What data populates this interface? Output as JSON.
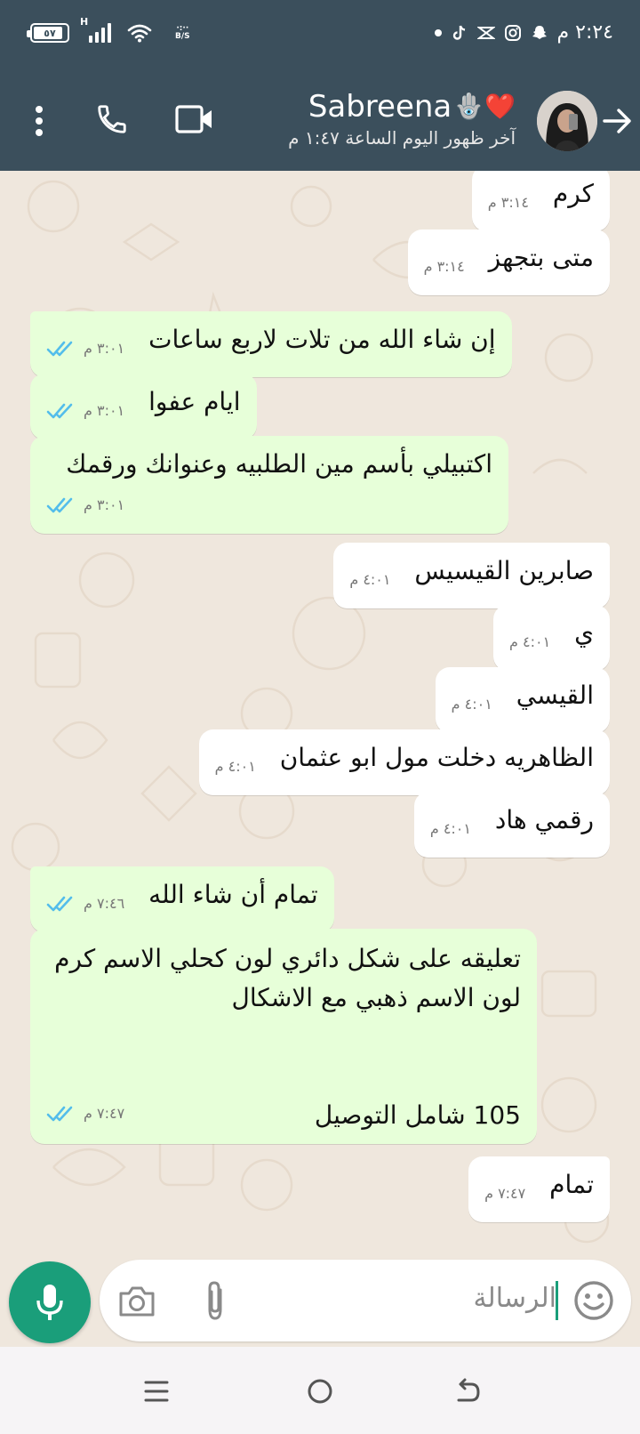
{
  "status_bar": {
    "time": "٢:٢٤ م",
    "battery": "٥٧",
    "network": "H",
    "data_speed_top": "·:··",
    "data_speed_bottom": "B/S"
  },
  "header": {
    "contact_name": "Sabreena",
    "emoji": "🪬❤️",
    "last_seen": "آخر ظهور اليوم الساعة ١:٤٧ م"
  },
  "messages": [
    {
      "dir": "in",
      "text": "كرم",
      "time": "٣:١٤ م"
    },
    {
      "dir": "in",
      "text": "متى بتجهز",
      "time": "٣:١٤ م"
    },
    {
      "dir": "out",
      "text": "إن شاء الله من تلات لاربع ساعات",
      "time": "٣:٠١ م"
    },
    {
      "dir": "out",
      "text": "ايام عفوا",
      "time": "٣:٠١ م"
    },
    {
      "dir": "out",
      "text": "اكتبيلي بأسم مين الطلبيه وعنوانك ورقمك",
      "time": "٣:٠١ م"
    },
    {
      "dir": "in",
      "text": "صابرين القيسيس",
      "time": "٤:٠١ م"
    },
    {
      "dir": "in",
      "text": "ي",
      "time": "٤:٠١ م"
    },
    {
      "dir": "in",
      "text": "القيسي",
      "time": "٤:٠١ م"
    },
    {
      "dir": "in",
      "text": "الظاهريه دخلت مول ابو عثمان",
      "time": "٤:٠١ م"
    },
    {
      "dir": "in",
      "text": "رقمي هاد",
      "time": "٤:٠١ م"
    },
    {
      "dir": "out",
      "text": "تمام أن شاء الله",
      "time": "٧:٤٦ م"
    },
    {
      "dir": "out",
      "text": "تعليقه على شكل دائري لون كحلي الاسم كرم\nلون الاسم ذهبي مع الاشكال\n\n\n105 شامل التوصيل",
      "time": "٧:٤٧ م"
    },
    {
      "dir": "in",
      "text": "تمام",
      "time": "٧:٤٧ م"
    }
  ],
  "input": {
    "placeholder": "الرسالة"
  },
  "icons": {
    "mic": "mic-icon",
    "camera": "camera-icon",
    "attach": "paperclip-icon",
    "emoji": "emoji-icon",
    "call": "phone-icon",
    "video": "video-icon",
    "menu": "more-vert-icon",
    "back": "back-arrow-icon"
  },
  "colors": {
    "header": "#3b4f5c",
    "outgoing_bubble": "#e7ffd9",
    "incoming_bubble": "#ffffff",
    "accent": "#1a9e7a",
    "read_ticks": "#53bdeb"
  }
}
